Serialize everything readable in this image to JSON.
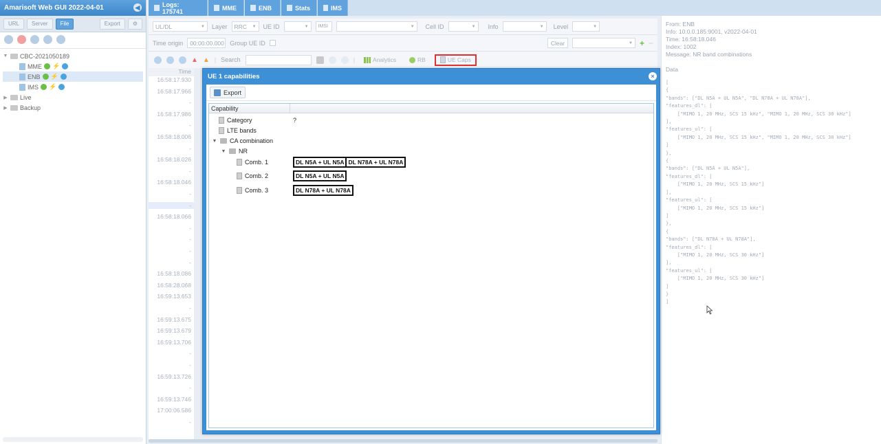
{
  "app": {
    "title": "Amarisoft Web GUI 2022-04-01"
  },
  "left": {
    "tabs": [
      "URL",
      "Server",
      "File"
    ],
    "active_tab": "File",
    "export_label": "Export",
    "tree": [
      {
        "label": "CBC-2021050189",
        "level": 0,
        "expanded": true
      },
      {
        "label": "MME",
        "level": 1
      },
      {
        "label": "ENB",
        "level": 1,
        "selected": true
      },
      {
        "label": "IMS",
        "level": 1
      },
      {
        "label": "Live",
        "level": 0,
        "expanded": false
      },
      {
        "label": "Backup",
        "level": 0,
        "expanded": false
      }
    ]
  },
  "top_tabs": [
    {
      "label": "Logs: 175741"
    },
    {
      "label": "MME"
    },
    {
      "label": "ENB"
    },
    {
      "label": "Stats"
    },
    {
      "label": "IMS"
    }
  ],
  "filters": {
    "updl": "UL/DL",
    "layer_label": "Layer",
    "layer_value": "RRC",
    "ueid_label": "UE ID",
    "imsi_label": "IMSI",
    "cellid_label": "Cell ID",
    "info_label": "Info",
    "level_label": "Level",
    "time_origin_label": "Time origin",
    "time_origin_value": "00:00:00.000",
    "group_ueid_label": "Group UE ID",
    "clear_label": "Clear"
  },
  "toolbar": {
    "search_label": "Search",
    "analytics_label": "Analytics",
    "rb_label": "RB",
    "uecaps_label": "UE Caps"
  },
  "time_column": {
    "header": "Time",
    "rows": [
      "16:58:17.930",
      "16:58:17.966",
      "-",
      "16:58:17.986",
      "-",
      "16:58:18.006",
      "-",
      "16:58:18.026",
      "-",
      "16:58:18.046",
      "-",
      "-",
      "16:58:18.066",
      "-",
      "-",
      "-",
      "-",
      "16:58:18.086",
      "16:58:28.068",
      "16:59:13.653",
      "-",
      "16:59:13.675",
      "16:59:13.679",
      "16:59:13.706",
      "-",
      "-",
      "16:59:13.726",
      "-",
      "16:59:13.746",
      "17:00:06.586",
      "-"
    ]
  },
  "modal": {
    "title": "UE 1 capabilities",
    "export_label": "Export",
    "column_header": "Capability",
    "rows": [
      {
        "label": "Category",
        "value": "?",
        "level": 1,
        "type": "leaf"
      },
      {
        "label": "LTE bands",
        "value": "",
        "level": 1,
        "type": "leaf"
      },
      {
        "label": "CA combination",
        "value": "",
        "level": 1,
        "type": "folder"
      },
      {
        "label": "NR",
        "value": "",
        "level": 2,
        "type": "folder"
      },
      {
        "label": "Comb. 1",
        "level": 3,
        "type": "leaf",
        "combos": [
          "DL N5A + UL N5A",
          "DL N78A + UL N78A"
        ]
      },
      {
        "label": "Comb. 2",
        "level": 3,
        "type": "leaf",
        "combos": [
          "DL N5A + UL N5A"
        ]
      },
      {
        "label": "Comb. 3",
        "level": 3,
        "type": "leaf",
        "combos": [
          "DL N78A + UL N78A"
        ]
      }
    ]
  },
  "details": {
    "from": "From: ENB",
    "info": "Info: 10.0.0.185:9001, v2022-04-01",
    "time": "Time: 16:58:18.046",
    "index": "Index: 1002",
    "message": "Message: NR band combinations",
    "data_label": "Data",
    "code_lines": [
      "[",
      "{",
      "\"bands\": [\"DL N5A + UL N5A\", \"DL N78A + UL N78A\"],",
      "\"features_dl\": [",
      "    [\"MIMO 1, 20 MHz, SCS 15 kHz\", \"MIMO 1, 20 MHz, SCS 30 kHz\"]",
      "],",
      "\"features_ul\": [",
      "    [\"MIMO 1, 20 MHz, SCS 15 kHz\", \"MIMO 1, 20 MHz, SCS 30 kHz\"]",
      "]",
      "},",
      "{",
      "\"bands\": [\"DL N5A + UL N5A\"],",
      "\"features_dl\": [",
      "    [\"MIMO 1, 20 MHz, SCS 15 kHz\"]",
      "],",
      "\"features_ul\": [",
      "    [\"MIMO 1, 20 MHz, SCS 15 kHz\"]",
      "]",
      "},",
      "{",
      "\"bands\": [\"DL N78A + UL N78A\"],",
      "\"features_dl\": [",
      "    [\"MIMO 1, 20 MHz, SCS 30 kHz\"]",
      "],",
      "\"features_ul\": [",
      "    [\"MIMO 1, 20 MHz, SCS 30 kHz\"]",
      "]",
      "}",
      "]"
    ]
  },
  "colors": {
    "accent": "#3d8fd6",
    "header": "#5fa2dd",
    "highlight": "#e03030"
  }
}
